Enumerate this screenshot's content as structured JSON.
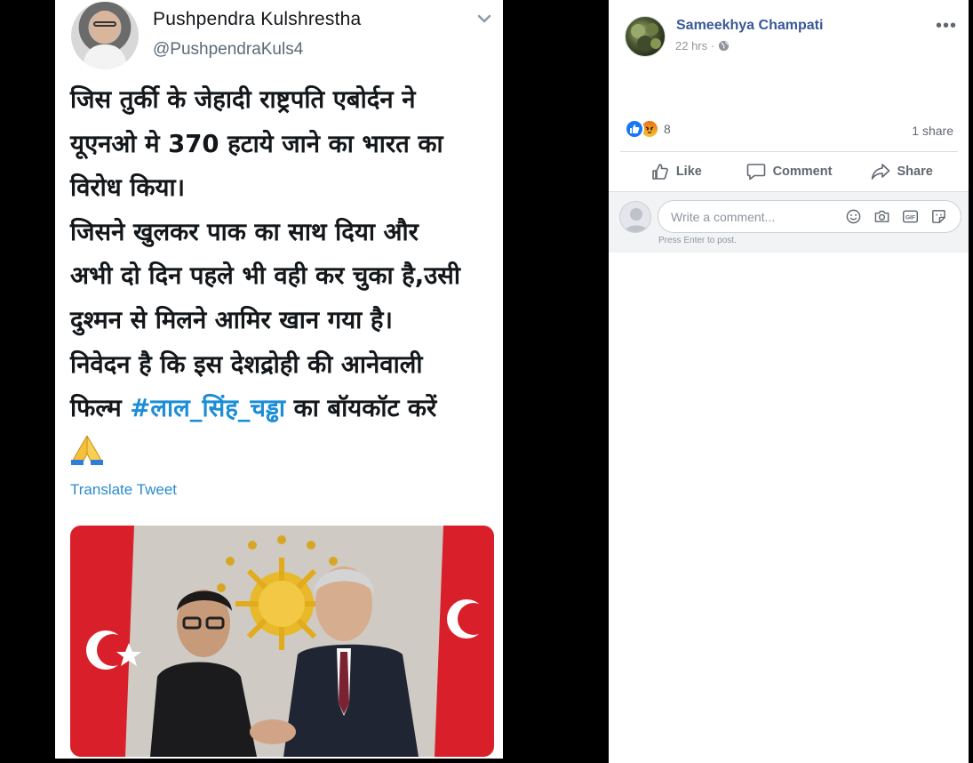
{
  "tweet": {
    "author_name": "Pushpendra Kulshrestha",
    "author_handle": "@PushpendraKuls4",
    "text_part1": "जिस तुर्की के जेहादी राष्ट्रपति एबोर्दन ने\nयूएनओ मे 370 हटाये जाने का भारत का\nविरोध किया।\nजिसने खुलकर पाक का साथ दिया और\nअभी दो दिन पहले भी वही कर चुका है,उसी\nदुश्मन से मिलने आमिर खान गया है।\nनिवेदन है कि इस देशद्रोही की आनेवाली\nफिल्म ",
    "hashtag": "#लाल_सिंह_चड्ढा",
    "text_part2": " का बॉयकॉट करें",
    "translate_label": "Translate Tweet"
  },
  "post": {
    "author_name": "Sameekhya Champati",
    "timestamp": "22 hrs ·",
    "more_label": "•••",
    "reaction_count": "8",
    "share_count": "1 share"
  },
  "actions": {
    "like_label": "Like",
    "comment_label": "Comment",
    "share_label": "Share"
  },
  "comment_box": {
    "placeholder": "Write a comment...",
    "hint": "Press Enter to post."
  }
}
